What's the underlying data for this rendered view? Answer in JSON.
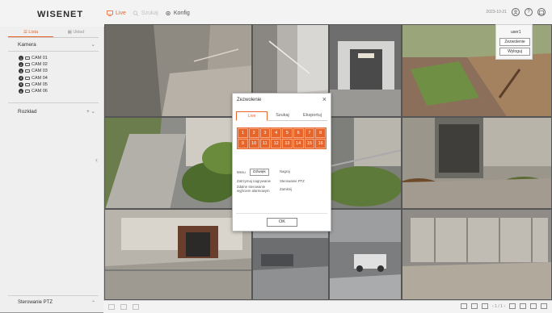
{
  "header": {
    "logo": "WISENET",
    "nav": [
      {
        "label": "Live",
        "icon": "monitor-icon",
        "state": "active"
      },
      {
        "label": "Szukaj",
        "icon": "search-icon",
        "state": "disabled"
      },
      {
        "label": "Konfig",
        "icon": "gear-icon",
        "state": "normal"
      }
    ],
    "datetime": "2023-10-21",
    "icons": [
      "user-icon",
      "help-icon",
      "exit-icon"
    ]
  },
  "sidebar": {
    "tabs": [
      {
        "label": "Lista",
        "icon": "list-icon",
        "active": true
      },
      {
        "label": "Układ",
        "icon": "layout-icon",
        "active": false
      }
    ],
    "camera_section": "Kamera",
    "cameras": [
      {
        "num": "1",
        "label": "CAM 01"
      },
      {
        "num": "2",
        "label": "CAM 02"
      },
      {
        "num": "3",
        "label": "CAM 03"
      },
      {
        "num": "4",
        "label": "CAM 04"
      },
      {
        "num": "5",
        "label": "CAM 05"
      },
      {
        "num": "6",
        "label": "CAM 06"
      }
    ],
    "layout_section": "Rozkład",
    "ptz_section": "Sterowanie PTZ"
  },
  "user_menu": {
    "user": "user1",
    "buttons": [
      "Zezwolenie",
      "Wyloguj"
    ]
  },
  "dialog": {
    "title": "Zezwolenie",
    "tabs": [
      "Live",
      "Szukaj",
      "Eksportuj"
    ],
    "active_tab": "Live",
    "channels": [
      "1",
      "2",
      "3",
      "4",
      "5",
      "6",
      "7",
      "8",
      "9",
      "10",
      "11",
      "12",
      "13",
      "14",
      "15",
      "16"
    ],
    "rows": {
      "menu_label": "Menu",
      "menu_value": "Dźwięk",
      "menu_value2": "Nagraj",
      "rec_label": "Zatrzymaj nagrywanie",
      "rec_value": "Sterowanie PTZ",
      "alarm_label": "Zdalne sterowanie wyjściem alarmowym",
      "alarm_value": "Zamknij"
    },
    "ok": "OK"
  },
  "bottombar": {
    "pager": "1 / 1"
  },
  "colors": {
    "accent": "#e8652a",
    "topbar": "#f3f3f3",
    "sidebar": "#efefef"
  }
}
